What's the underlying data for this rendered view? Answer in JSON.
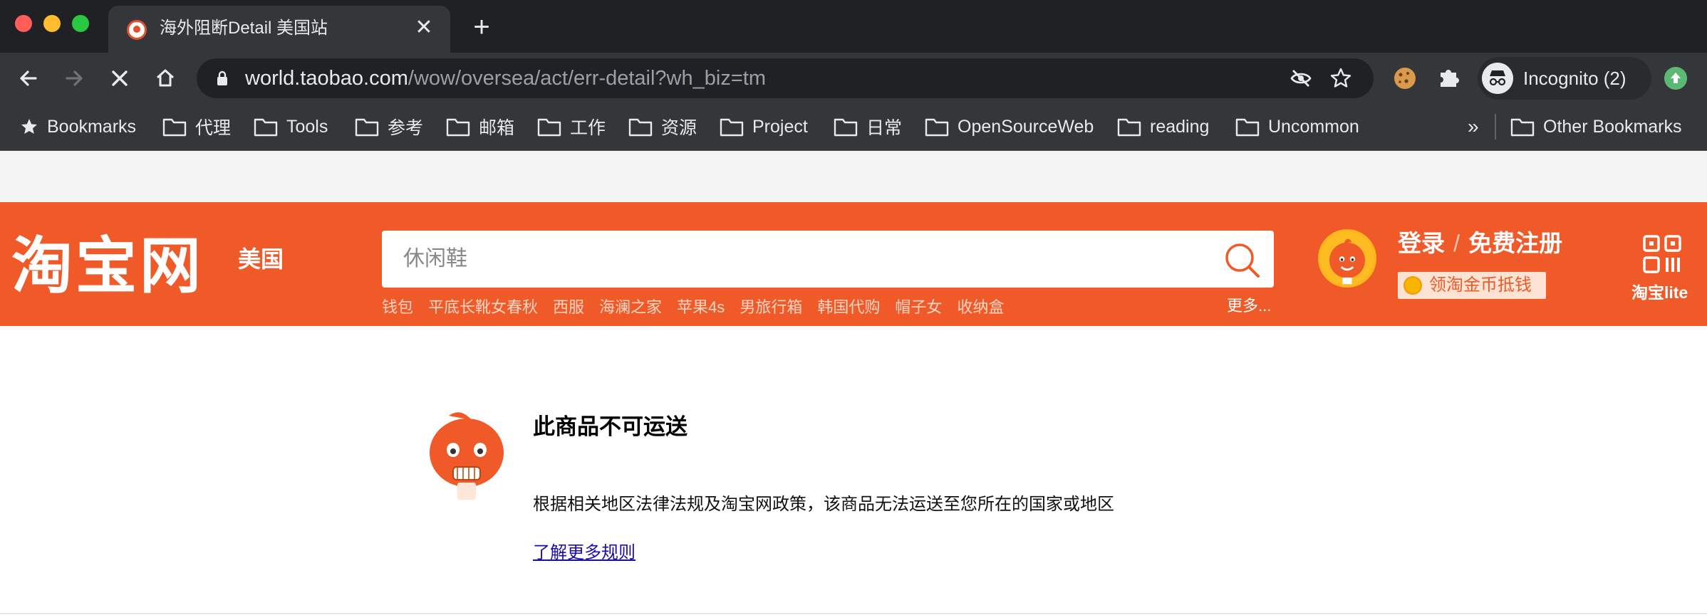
{
  "browser": {
    "tab": {
      "title": "海外阻断Detail 美国站",
      "close_glyph": "✕"
    },
    "new_tab_glyph": "+",
    "url": {
      "host": "world.taobao.com",
      "path": "/wow/oversea/act/err-detail?wh_biz=tm"
    },
    "profile_label": "Incognito (2)",
    "bookmarks": [
      {
        "label": "Bookmarks",
        "icon": "star-icon"
      },
      {
        "label": "代理",
        "icon": "folder-icon"
      },
      {
        "label": "Tools",
        "icon": "folder-icon"
      },
      {
        "label": "参考",
        "icon": "folder-icon"
      },
      {
        "label": "邮箱",
        "icon": "folder-icon"
      },
      {
        "label": "工作",
        "icon": "folder-icon"
      },
      {
        "label": "资源",
        "icon": "folder-icon"
      },
      {
        "label": "Project",
        "icon": "folder-icon"
      },
      {
        "label": "日常",
        "icon": "folder-icon"
      },
      {
        "label": "OpenSourceWeb",
        "icon": "folder-icon"
      },
      {
        "label": "reading",
        "icon": "folder-icon"
      },
      {
        "label": "Uncommon",
        "icon": "folder-icon"
      }
    ],
    "bookmarks_overflow": "»",
    "other_bookmarks": "Other Bookmarks"
  },
  "header": {
    "logo_text": "淘宝网",
    "region": "美国",
    "search_placeholder": "休闲鞋",
    "hot_keywords": [
      "钱包",
      "平底长靴女春秋",
      "西服",
      "海澜之家",
      "苹果4s",
      "男旅行箱",
      "韩国代购",
      "帽子女",
      "收纳盒"
    ],
    "more_label": "更多...",
    "login_label": "登录",
    "login_sep": "/",
    "register_label": "免费注册",
    "coin_label": "领淘金币抵钱",
    "lite_label": "淘宝lite",
    "brand_color": "#f05a28"
  },
  "error": {
    "title": "此商品不可运送",
    "description": "根据相关地区法律法规及淘宝网政策，该商品无法运送至您所在的国家或地区",
    "link_label": "了解更多规则"
  }
}
